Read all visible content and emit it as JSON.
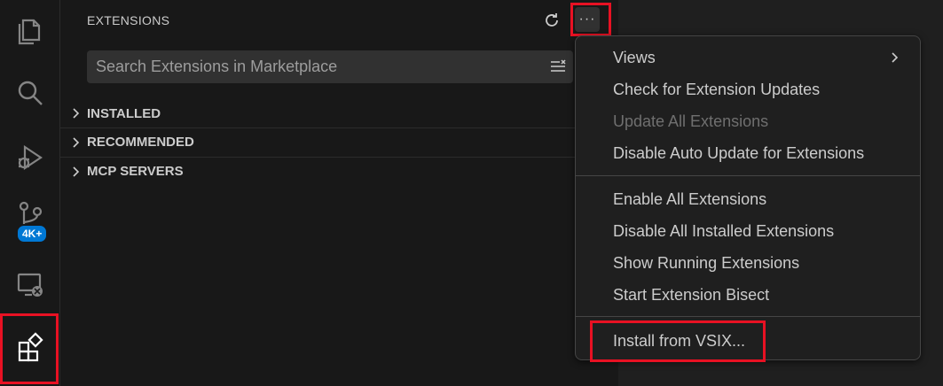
{
  "activity_bar": {
    "items": [
      {
        "name": "explorer",
        "icon": "files-icon"
      },
      {
        "name": "search",
        "icon": "search-icon"
      },
      {
        "name": "run-debug",
        "icon": "run-debug-icon"
      },
      {
        "name": "source-control",
        "icon": "source-control-icon",
        "badge": "4K+"
      },
      {
        "name": "remote-explorer",
        "icon": "remote-explorer-icon"
      },
      {
        "name": "extensions",
        "icon": "extensions-icon",
        "active": true
      }
    ],
    "badge_color": "#0078d4"
  },
  "sidebar": {
    "title": "EXTENSIONS",
    "refresh_icon": "refresh-icon",
    "more_actions_label": "···",
    "search": {
      "placeholder": "Search Extensions in Marketplace"
    },
    "sections": [
      {
        "label": "INSTALLED"
      },
      {
        "label": "RECOMMENDED"
      },
      {
        "label": "MCP SERVERS"
      }
    ]
  },
  "menu": {
    "groups": [
      [
        {
          "label": "Views",
          "submenu": true
        },
        {
          "label": "Check for Extension Updates"
        },
        {
          "label": "Update All Extensions",
          "disabled": true
        },
        {
          "label": "Disable Auto Update for Extensions"
        }
      ],
      [
        {
          "label": "Enable All Extensions"
        },
        {
          "label": "Disable All Installed Extensions"
        },
        {
          "label": "Show Running Extensions"
        },
        {
          "label": "Start Extension Bisect"
        }
      ],
      [
        {
          "label": "Install from VSIX..."
        }
      ]
    ]
  },
  "highlight_color": "#e81123"
}
